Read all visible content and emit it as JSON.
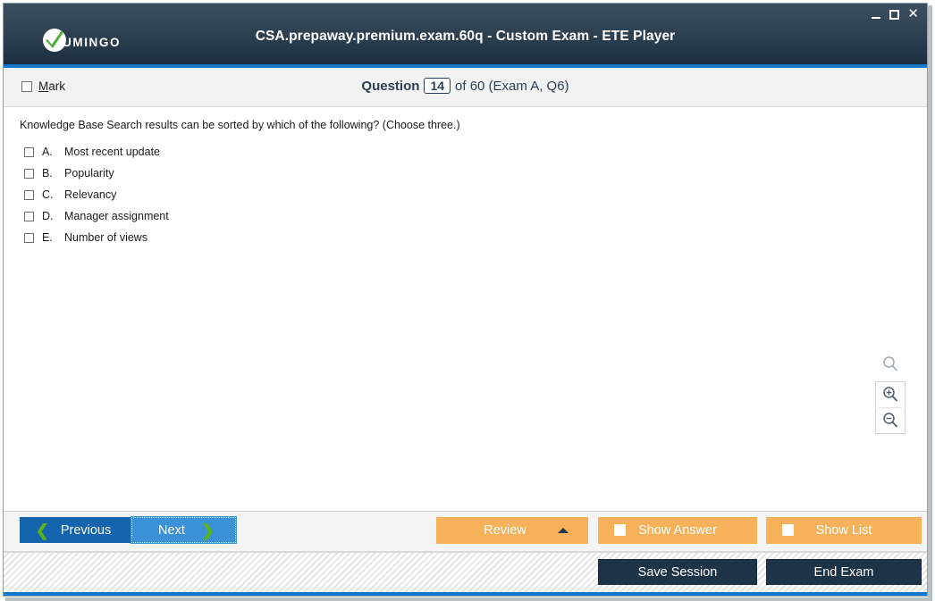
{
  "window": {
    "logo_text": "UMINGO",
    "logo_icon": "check-circle-logo-icon",
    "title": "CSA.prepaway.premium.exam.60q - Custom Exam - ETE Player",
    "controls": {
      "minimize": "minimize-icon",
      "maximize": "maximize-icon",
      "close": "✕"
    }
  },
  "question_header": {
    "mark_label_prefix": "M",
    "mark_label_rest": "ark",
    "question_label": "Question",
    "question_number": "14",
    "of_text": "of 60 (Exam A, Q6)"
  },
  "question": {
    "text": "Knowledge Base Search results can be sorted by which of the following? (Choose three.)",
    "options": [
      {
        "letter": "A.",
        "text": "Most recent update",
        "checked": false
      },
      {
        "letter": "B.",
        "text": "Popularity",
        "checked": false
      },
      {
        "letter": "C.",
        "text": "Relevancy",
        "checked": false
      },
      {
        "letter": "D.",
        "text": "Manager assignment",
        "checked": false
      },
      {
        "letter": "E.",
        "text": "Number of views",
        "checked": false
      }
    ]
  },
  "zoom_controls": {
    "search": "magnifier-icon",
    "zoom_in": "zoom-in-icon",
    "zoom_out": "zoom-out-icon"
  },
  "toolbar": {
    "previous": "Previous",
    "next": "Next",
    "review": "Review",
    "show_answer": "Show Answer",
    "show_list": "Show List"
  },
  "statusbar": {
    "save_session": "Save Session",
    "end_exam": "End Exam"
  },
  "colors": {
    "titlebar_top": "#3c4f61",
    "titlebar_bottom": "#1b2b3b",
    "accent_blue": "#1379cd",
    "prev_blue": "#1464ae",
    "next_blue": "#3b91d8",
    "orange": "#f7b15a",
    "dark_navy": "#1d3347",
    "chevron_green": "#5cb319"
  }
}
